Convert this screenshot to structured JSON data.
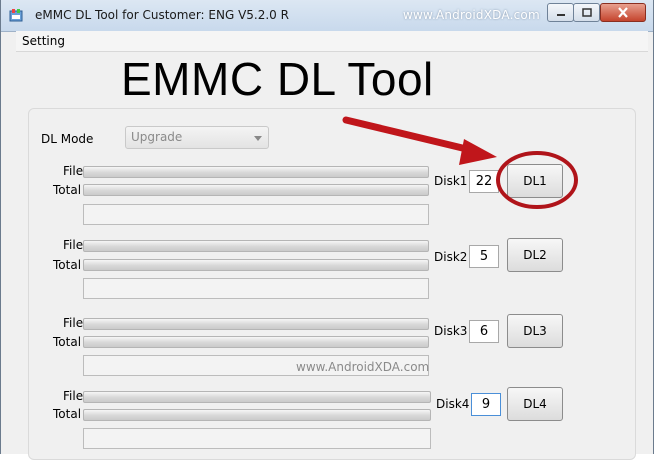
{
  "window": {
    "title": "eMMC DL Tool for Customer: ENG V5.2.0 R",
    "title_watermark": "www.AndroidXDA.com",
    "controls": [
      "minimize-icon",
      "maximize-icon",
      "close-icon"
    ]
  },
  "menu": {
    "setting": "Setting"
  },
  "overlay": {
    "big_title": "EMMC DL Tool",
    "arrow_color": "#c0161b",
    "circle_color": "#b0141a",
    "watermark": "www.AndroidXDA.com"
  },
  "dl_mode": {
    "label": "DL Mode",
    "value": "Upgrade"
  },
  "disks": [
    {
      "file_label": "File",
      "total_label": "Total",
      "disk_label": "Disk1",
      "number": "22",
      "button": "DL1"
    },
    {
      "file_label": "File",
      "total_label": "Total",
      "disk_label": "Disk2",
      "number": "5",
      "button": "DL2"
    },
    {
      "file_label": "File",
      "total_label": "Total",
      "disk_label": "Disk3",
      "number": "6",
      "button": "DL3"
    },
    {
      "file_label": "File",
      "total_label": "Total",
      "disk_label": "Disk4",
      "number": "9",
      "button": "DL4"
    }
  ],
  "colors": {
    "titlebar": "#c8d9ec",
    "close_button": "#c4442d",
    "highlight": "#b0141a"
  }
}
